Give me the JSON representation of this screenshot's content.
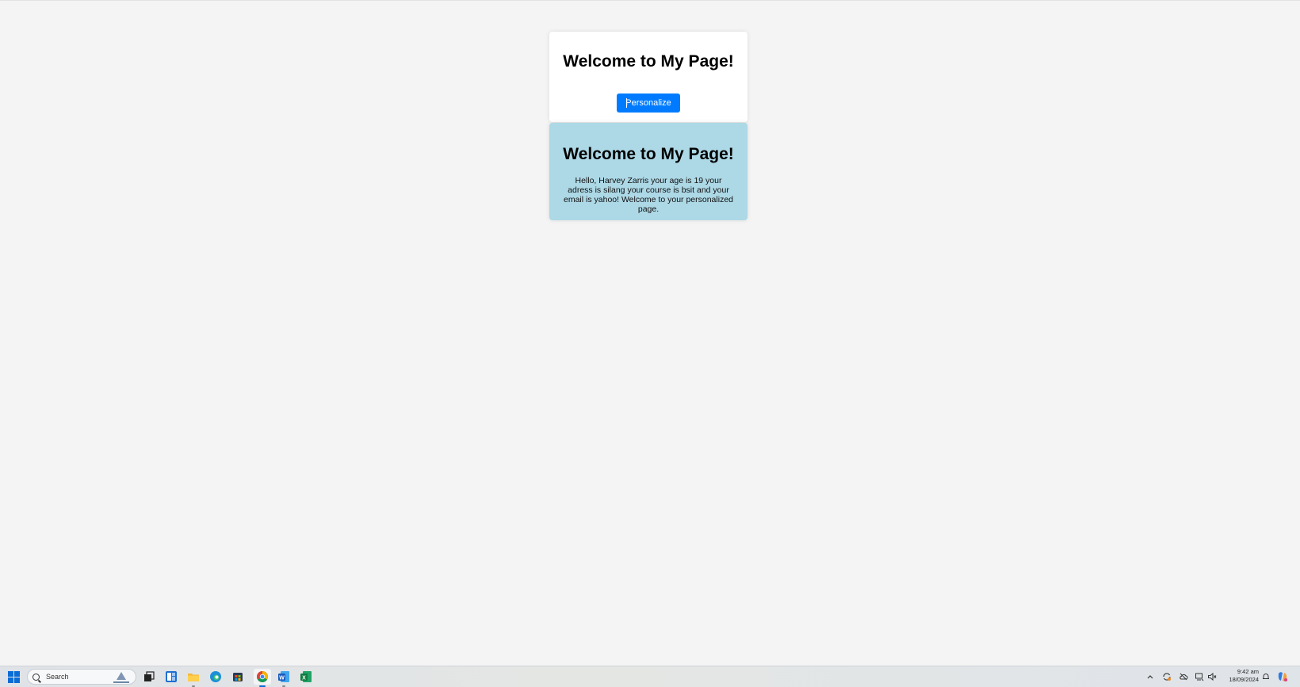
{
  "card_top": {
    "heading": "Welcome to My Page!",
    "button_label": "Personalize"
  },
  "card_bottom": {
    "heading": "Welcome to My Page!",
    "message": "Hello, Harvey Zarris your age is 19 your adress is silang your course is bsit and your email is yahoo! Welcome to your personalized page."
  },
  "taskbar": {
    "search_placeholder": "Search",
    "apps": [
      "start-icon",
      "task-view-icon",
      "widgets-icon",
      "file-explorer-icon",
      "edge-icon",
      "store-icon",
      "chrome-icon",
      "word-icon",
      "excel-icon"
    ],
    "clock_time": "9:42 am",
    "clock_date": "18/09/2024"
  },
  "colors": {
    "page_bg": "#f4f4f4",
    "card_top_bg": "#ffffff",
    "card_bottom_bg": "#add8e6",
    "button_bg": "#007bff"
  }
}
